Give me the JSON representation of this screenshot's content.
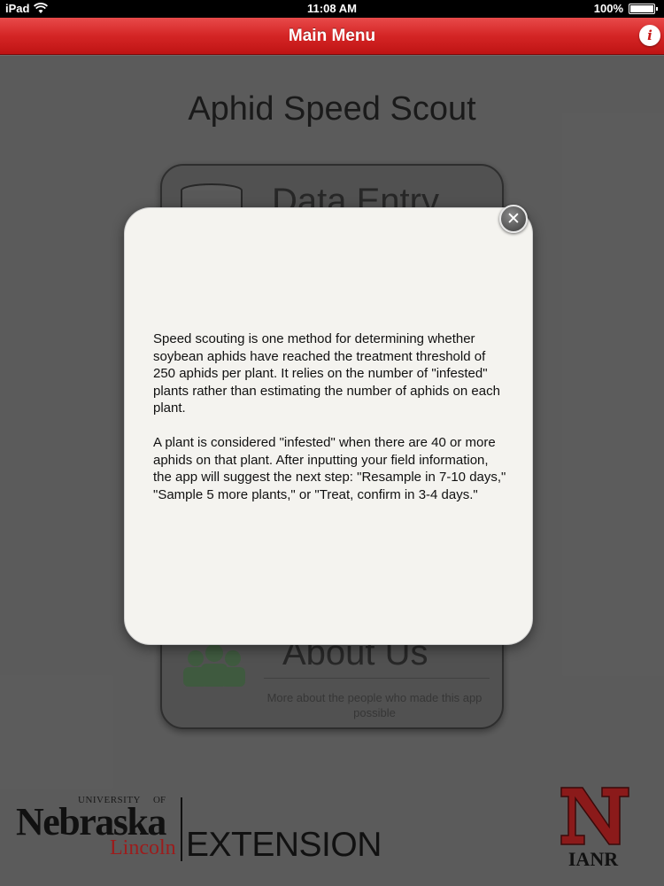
{
  "status_bar": {
    "device": "iPad",
    "time": "11:08 AM",
    "battery": "100%",
    "wifi_icon": "wifi-icon",
    "battery_icon": "battery-icon"
  },
  "nav": {
    "title": "Main Menu",
    "info_label": "i",
    "color": "#d42525"
  },
  "page": {
    "app_title": "Aphid Speed Scout",
    "menu": {
      "data_entry_label": "Data Entry",
      "about_label": "About Us",
      "about_description": "More about the people who made this app possible"
    }
  },
  "popup": {
    "close_label": "✕",
    "paragraphs": [
      "Speed scouting is one method for determining whether soybean aphids have reached the treatment threshold of 250 aphids per plant. It relies on the number of \"infested\" plants rather than estimating the number of aphids on each plant.",
      "A plant is considered \"infested\" when there are 40 or more aphids on that plant. After inputting your field information, the app will suggest the next step: \"Resample in 7-10 days,\" \"Sample 5 more plants,\" or \"Treat, confirm in 3-4 days.\""
    ]
  },
  "footer": {
    "unl": {
      "university": "UNIVERSITY",
      "of": "OF",
      "nebraska": "Nebraska",
      "lincoln": "Lincoln",
      "extension": "EXTENSION",
      "accent": "#9c1c1c"
    },
    "ianr": {
      "text": "IANR",
      "accent": "#8b1a1a"
    }
  }
}
